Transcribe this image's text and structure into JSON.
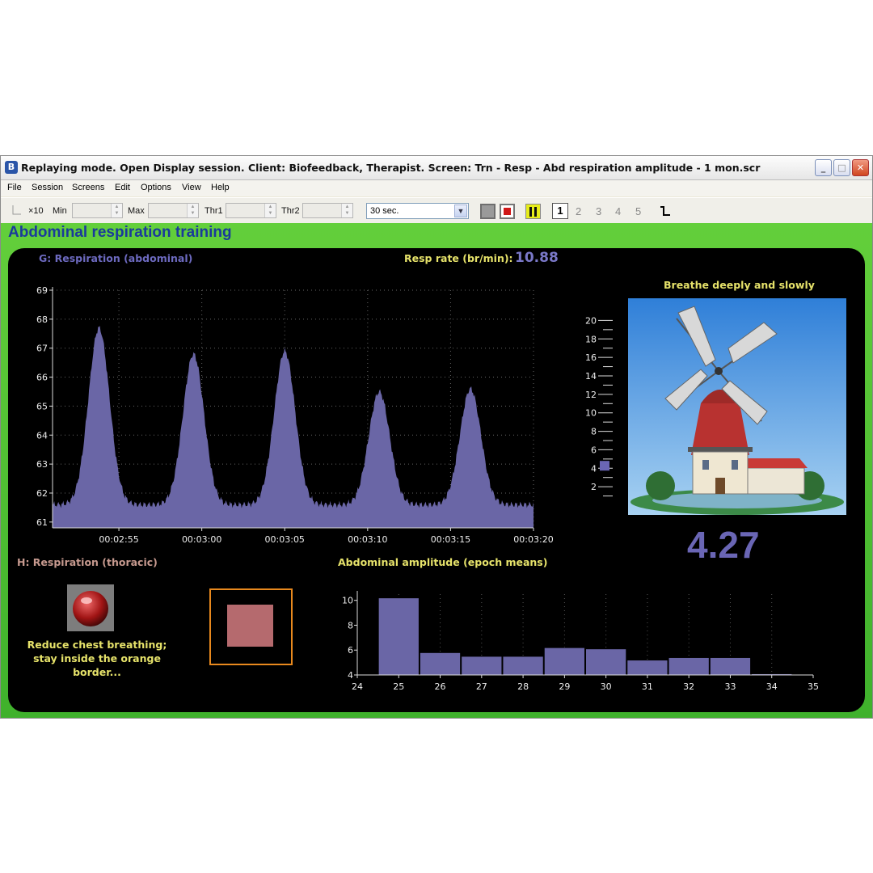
{
  "window": {
    "title": "Replaying mode. Open Display session. Client: Biofeedback, Therapist. Screen: Trn - Resp - Abd respiration amplitude - 1 mon.scr",
    "app_icon": "biograph-icon",
    "buttons": {
      "minimize": "_",
      "maximize": "□",
      "close": "✕"
    }
  },
  "menu": [
    "File",
    "Session",
    "Screens",
    "Edit",
    "Options",
    "View",
    "Help"
  ],
  "toolbar": {
    "x10_label": "×10",
    "min_label": "Min",
    "max_label": "Max",
    "thr1_label": "Thr1",
    "thr2_label": "Thr2",
    "time_window": "30 sec.",
    "pages": [
      "1",
      "2",
      "3",
      "4",
      "5"
    ]
  },
  "screen": {
    "title": "Abdominal respiration training",
    "respiration_title": "G: Respiration (abdominal)",
    "resp_rate_label": "Resp rate (br/min):",
    "resp_rate_value": "10.88",
    "instruction": "Breathe deeply and slowly",
    "amplitude_value": "4.27",
    "thoracic_title": "H: Respiration (thoracic)",
    "reduce_text_1": "Reduce chest breathing;",
    "reduce_text_2": "stay inside the orange",
    "reduce_text_3": "border...",
    "epoch_title": "Abdominal amplitude (epoch means)"
  },
  "colors": {
    "trace_fill": "#6a66a6",
    "label_yellow": "#e6e26a",
    "thoracic_label": "#c79a8f",
    "resp_rate_value": "#7a78c8",
    "amplitude_value": "#6a66b5",
    "orange_border": "#e8891e",
    "pink_square": "#b56a6e",
    "green_bg": "#4cc033"
  },
  "chart_data": [
    {
      "type": "area",
      "title": "G: Respiration (abdominal)",
      "ylim": [
        60.8,
        69
      ],
      "yticks": [
        61,
        62,
        63,
        64,
        65,
        66,
        67,
        68,
        69
      ],
      "xlim_seconds": [
        171,
        200
      ],
      "xtick_labels": [
        "00:02:55",
        "00:03:00",
        "00:03:05",
        "00:03:10",
        "00:03:15",
        "00:03:20"
      ],
      "xtick_seconds": [
        175,
        180,
        185,
        190,
        195,
        200
      ],
      "baseline": 61.6,
      "peaks": [
        {
          "t": 173.8,
          "y": 67.7
        },
        {
          "t": 179.5,
          "y": 66.8
        },
        {
          "t": 185.0,
          "y": 66.9
        },
        {
          "t": 190.7,
          "y": 65.5
        },
        {
          "t": 196.2,
          "y": 65.6
        }
      ],
      "grid": true
    },
    {
      "type": "bar",
      "title": "Abdominal amplitude (epoch means)",
      "x": [
        25,
        26,
        27,
        28,
        29,
        30,
        31,
        32,
        33,
        34
      ],
      "values": [
        10.2,
        5.8,
        5.5,
        5.5,
        6.2,
        6.1,
        5.2,
        5.4,
        5.4,
        4.1
      ],
      "xlim": [
        24,
        35
      ],
      "xticks": [
        24,
        25,
        26,
        27,
        28,
        29,
        30,
        31,
        32,
        33,
        34,
        35
      ],
      "ylim": [
        4,
        10.5
      ],
      "yticks": [
        4,
        6,
        8,
        10
      ]
    },
    {
      "type": "bar",
      "title": "amplitude gauge",
      "ylim": [
        0,
        21
      ],
      "yticks": [
        2,
        4,
        6,
        8,
        10,
        12,
        14,
        16,
        18,
        20
      ],
      "value": 4.27
    }
  ]
}
